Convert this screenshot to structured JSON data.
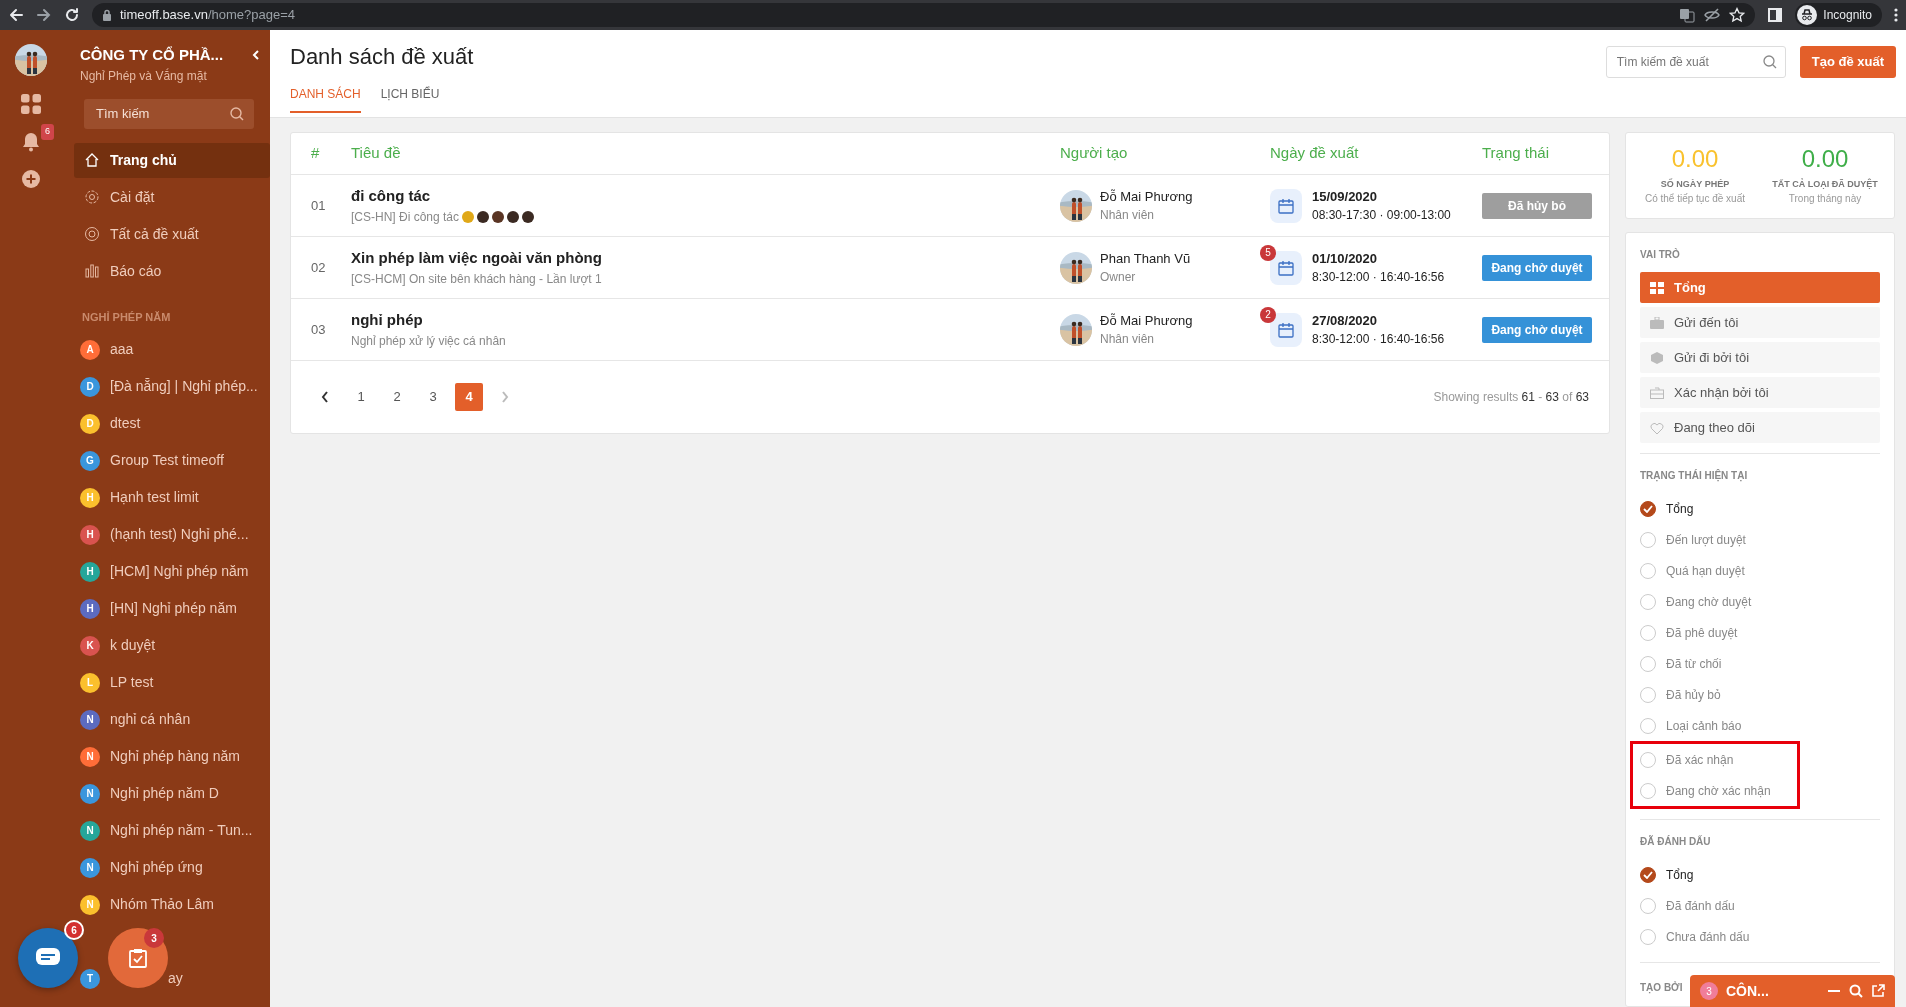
{
  "browser": {
    "url_host": "timeoff.base.vn",
    "url_path": "/home?page=4",
    "profile": "Incognito"
  },
  "sidebar": {
    "company": "CÔNG TY CỔ PHẦ...",
    "app": "Nghỉ Phép và Vắng mặt",
    "notification_count": "6",
    "search": {
      "placeholder": "Tìm kiếm"
    },
    "menu": [
      {
        "label": "Trang chủ",
        "selected": true
      },
      {
        "label": "Cài đặt",
        "selected": false
      },
      {
        "label": "Tất cả đề xuất",
        "selected": false
      },
      {
        "label": "Báo cáo",
        "selected": false
      }
    ],
    "section": "NGHỈ PHÉP NĂM",
    "groups": [
      {
        "kind": "group",
        "letter": "A",
        "label": "aaa",
        "color": "#ff6d38"
      },
      {
        "kind": "group",
        "letter": "D",
        "label": "[Đà nẵng] | Nghỉ phép...",
        "color": "#3a96dd"
      },
      {
        "kind": "group",
        "letter": "D",
        "label": "dtest",
        "color": "#fbc02d"
      },
      {
        "kind": "group",
        "letter": "G",
        "label": "Group Test timeoff",
        "color": "#3a96dd"
      },
      {
        "kind": "group",
        "letter": "H",
        "label": "Hạnh test limit",
        "color": "#fbc02d"
      },
      {
        "kind": "group",
        "letter": "H",
        "label": "(hạnh test) Nghỉ phé...",
        "color": "#d9534f"
      },
      {
        "kind": "group",
        "letter": "H",
        "label": "[HCM] Nghỉ phép năm",
        "color": "#26a69a"
      },
      {
        "kind": "group",
        "letter": "H",
        "label": "[HN] Nghỉ phép năm",
        "color": "#5c6bc0"
      },
      {
        "kind": "group",
        "letter": "K",
        "label": "k duyệt",
        "color": "#d9534f"
      },
      {
        "kind": "group",
        "letter": "L",
        "label": "LP test",
        "color": "#fbc02d"
      },
      {
        "kind": "group",
        "letter": "N",
        "label": "nghỉ cá nhân",
        "color": "#5c6bc0"
      },
      {
        "kind": "group",
        "letter": "N",
        "label": "Nghỉ phép hàng năm",
        "color": "#ff6d38"
      },
      {
        "kind": "group",
        "letter": "N",
        "label": "Nghỉ phép năm D",
        "color": "#3a96dd"
      },
      {
        "kind": "group",
        "letter": "N",
        "label": "Nghỉ phép năm - Tun...",
        "color": "#26a69a"
      },
      {
        "kind": "group",
        "letter": "N",
        "label": "Nghỉ phép ứng",
        "color": "#3a96dd"
      },
      {
        "kind": "group",
        "letter": "N",
        "label": "Nhóm Thảo Lâm",
        "color": "#fbc02d"
      },
      {
        "kind": "covered",
        "letter": "T",
        "label": "ay",
        "color": "#3a96dd"
      }
    ],
    "chat_badge": "6",
    "task_badge": "3"
  },
  "header": {
    "title": "Danh sách đề xuất",
    "tabs": [
      {
        "label": "DANH SÁCH",
        "selected": true
      },
      {
        "label": "LỊCH BIỂU",
        "selected": false
      }
    ],
    "search": {
      "placeholder": "Tìm kiếm đề xuất"
    },
    "create_button": "Tạo đề xuất"
  },
  "table": {
    "columns": [
      "#",
      "Tiêu đề",
      "Người tạo",
      "Ngày đề xuất",
      "Trạng thái"
    ],
    "rows": [
      {
        "index": "01",
        "title": "đi công tác",
        "subtitle": "[CS-HN] Đi công tác",
        "emojis": [
          {
            "color": "#e0a818"
          },
          {
            "color": "#3b2a22"
          },
          {
            "color": "#5a3524"
          },
          {
            "color": "#3b2a22"
          },
          {
            "color": "#3b2a22"
          }
        ],
        "creator": "Đỗ Mai Phương",
        "role": "Nhân viên",
        "date": "15/09/2020",
        "times": "08:30-17:30 · 09:00-13:00",
        "status": "Đã hủy bỏ",
        "cancelled": true
      },
      {
        "index": "02",
        "title": "Xin phép làm việc ngoài văn phòng",
        "subtitle": "[CS-HCM] On site bên khách hàng - Lần lượt 1",
        "creator": "Phan Thanh Vũ",
        "role": "Owner",
        "date_badge": "5",
        "date": "01/10/2020",
        "times": "8:30-12:00 · 16:40-16:56",
        "status": "Đang chờ duyệt",
        "cancelled": false
      },
      {
        "index": "03",
        "title": "nghỉ phép",
        "subtitle": "Nghỉ phép xử lý việc cá nhân",
        "creator": "Đỗ Mai Phương",
        "role": "Nhân viên",
        "date_badge": "2",
        "date": "27/08/2020",
        "times": "8:30-12:00 · 16:40-16:56",
        "status": "Đang chờ duyệt",
        "cancelled": false
      }
    ],
    "pagination": {
      "pages": [
        {
          "label": "1",
          "selected": false
        },
        {
          "label": "2",
          "selected": false
        },
        {
          "label": "3",
          "selected": false
        },
        {
          "label": "4",
          "selected": true
        }
      ],
      "prev_disabled": false,
      "next_disabled": true
    },
    "results": "Showing results **61** - **63** of **63**"
  },
  "stats": [
    {
      "value": "0.00",
      "color": "#f9c22e",
      "label": "SỐ NGÀY PHÉP",
      "note": "Có thể tiếp tục đề xuất"
    },
    {
      "value": "0.00",
      "color": "#3fae49",
      "label": "TẤT CẢ LOẠI ĐÃ DUYỆT",
      "note": "Trong tháng này"
    }
  ],
  "roles": {
    "title": "VAI TRÒ",
    "items": [
      {
        "label": "Tổng",
        "selected": true
      },
      {
        "label": "Gửi đến tôi",
        "selected": false
      },
      {
        "label": "Gửi đi bởi tôi",
        "selected": false
      },
      {
        "label": "Xác nhận bởi tôi",
        "selected": false
      },
      {
        "label": "Đang theo dõi",
        "selected": false
      }
    ]
  },
  "status_filter": {
    "title": "TRẠNG THÁI HIỆN TẠI",
    "items": [
      {
        "label": "Tổng",
        "selected": true,
        "highlighted": false
      },
      {
        "label": "Đến lượt duyệt",
        "selected": false,
        "highlighted": false
      },
      {
        "label": "Quá hạn duyệt",
        "selected": false,
        "highlighted": false
      },
      {
        "label": "Đang chờ duyệt",
        "selected": false,
        "highlighted": false
      },
      {
        "label": "Đã phê duyệt",
        "selected": false,
        "highlighted": false
      },
      {
        "label": "Đã từ chối",
        "selected": false,
        "highlighted": false
      },
      {
        "label": "Đã hủy bỏ",
        "selected": false,
        "highlighted": false
      },
      {
        "label": "Loại cảnh báo",
        "selected": false,
        "highlighted": false
      },
      {
        "label": "Đã xác nhận",
        "selected": false,
        "highlighted": true
      },
      {
        "label": "Đang chờ xác nhận",
        "selected": false,
        "highlighted": true
      }
    ]
  },
  "mark_filter": {
    "title": "ĐÃ ĐÁNH DẤU",
    "items": [
      {
        "label": "Tổng",
        "selected": true
      },
      {
        "label": "Đã đánh dấu",
        "selected": false
      },
      {
        "label": "Chưa đánh dấu",
        "selected": false
      }
    ]
  },
  "creator_filter": {
    "title": "TẠO BỞI"
  },
  "chat_dock": {
    "badge": "3",
    "title": "CÔN..."
  }
}
